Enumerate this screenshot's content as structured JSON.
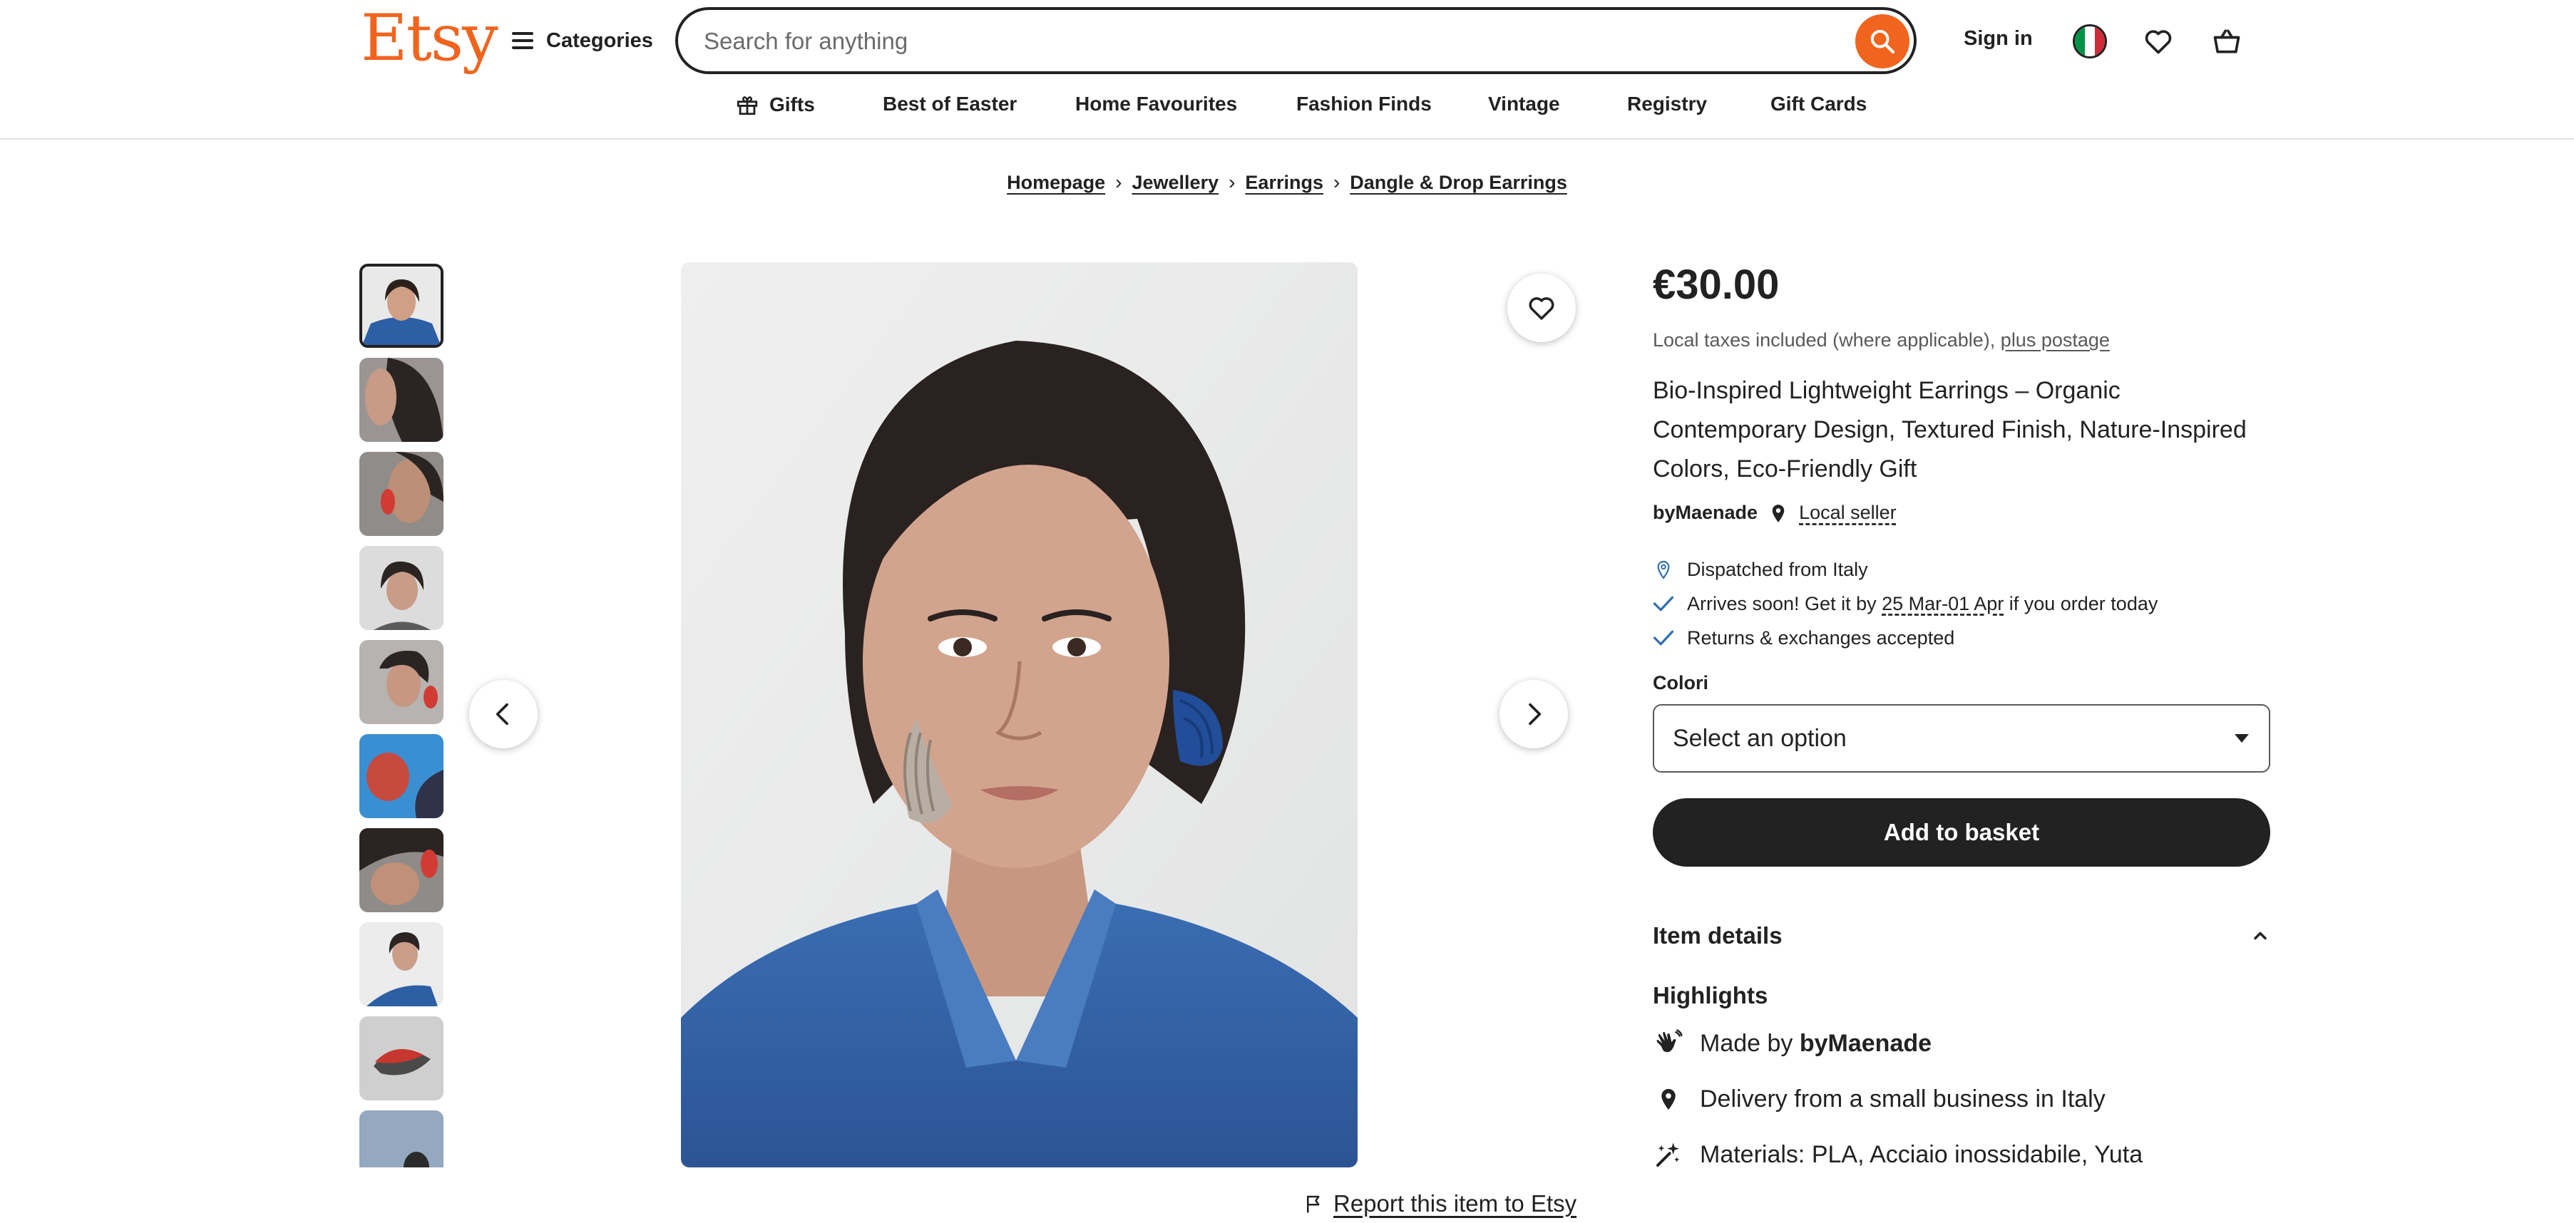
{
  "header": {
    "logo": "Etsy",
    "categories_label": "Categories",
    "search_placeholder": "Search for anything",
    "sign_in": "Sign in"
  },
  "nav": {
    "items": [
      "Gifts",
      "Best of Easter",
      "Home Favourites",
      "Fashion Finds",
      "Vintage",
      "Registry",
      "Gift Cards"
    ]
  },
  "breadcrumb": [
    "Homepage",
    "Jewellery",
    "Earrings",
    "Dangle & Drop Earrings"
  ],
  "gallery": {
    "thumbnail_count": 10,
    "active_index": 0
  },
  "product": {
    "price": "€30.00",
    "tax_note": "Local taxes included (where applicable),",
    "postage_link": "plus postage",
    "title": "Bio-Inspired Lightweight Earrings – Organic Contemporary Design, Textured Finish, Nature-Inspired Colors, Eco-Friendly Gift",
    "seller": "byMaenade",
    "local_seller": "Local seller",
    "dispatched": "Dispatched from Italy",
    "arrives_prefix": "Arrives soon! Get it by",
    "arrives_dates": "25 Mar-01 Apr",
    "arrives_suffix": "if you order today",
    "returns": "Returns & exchanges accepted",
    "variation_label": "Colori",
    "variation_value": "Select an option",
    "add_to_basket": "Add to basket",
    "item_details": "Item details",
    "highlights_title": "Highlights",
    "made_by_prefix": "Made by",
    "made_by_name": "byMaenade",
    "delivery": "Delivery from a small business in Italy",
    "materials": "Materials: PLA, Acciaio inossidabile, Yuta",
    "report": "Report this item to Etsy"
  },
  "colors": {
    "brand": "#f1641e",
    "text": "#222222",
    "muted": "#595959",
    "check": "#2f6fb3",
    "flag_green": "#009246",
    "flag_red": "#ce2b37"
  }
}
